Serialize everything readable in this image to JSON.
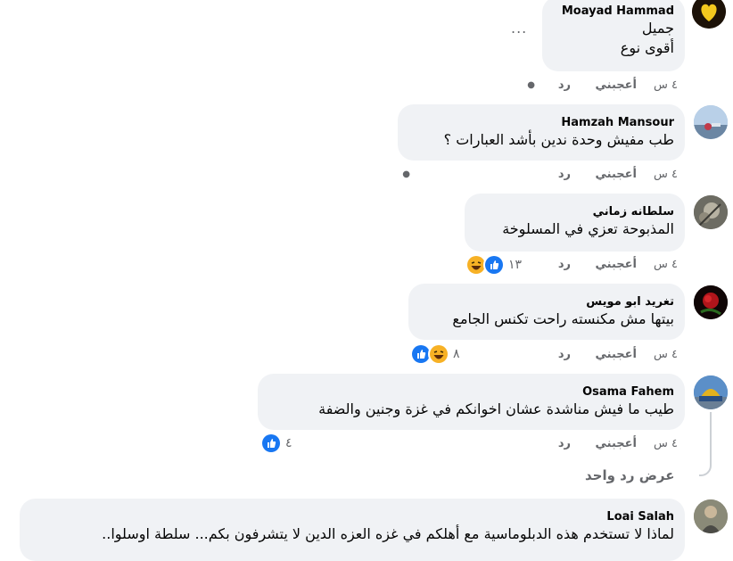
{
  "actions": {
    "time": "٤ س",
    "like": "أعجبني",
    "reply": "رد"
  },
  "comments": [
    {
      "name": "Moayad Hammad",
      "lines": [
        "جميل",
        "أقوى نوع"
      ],
      "more": "..."
    },
    {
      "name": "Hamzah Mansour",
      "lines": [
        "طب مفيش وحدة ندين بأشد العبارات ؟"
      ]
    },
    {
      "name": "سلطانه زماني",
      "lines": [
        "المذبوحة تعزي في المسلوخة"
      ],
      "reaction_count": "١٣"
    },
    {
      "name": "تغريد ابو مويس",
      "lines": [
        "بيتها مش مكنسته راحت تكنس الجامع"
      ],
      "reaction_count": "٨"
    },
    {
      "name": "Osama Fahem",
      "lines": [
        "طيب ما فيش مناشدة عشان اخوانكم في غزة وجنين والضفة"
      ],
      "reaction_count": "٤"
    },
    {
      "name": "Loai Salah",
      "lines": [
        "لماذا لا تستخدم هذه الدبلوماسية مع أهلكم في غزه العزه الدين لا يتشرفون بكم... سلطة اوسلوا.."
      ]
    }
  ],
  "view_one_reply": "عرض رد واحد",
  "colors": {
    "bubble": "#f0f2f5",
    "meta": "#65676b",
    "like_blue": "#1877f2",
    "haha_yellow": "#f7b125"
  }
}
